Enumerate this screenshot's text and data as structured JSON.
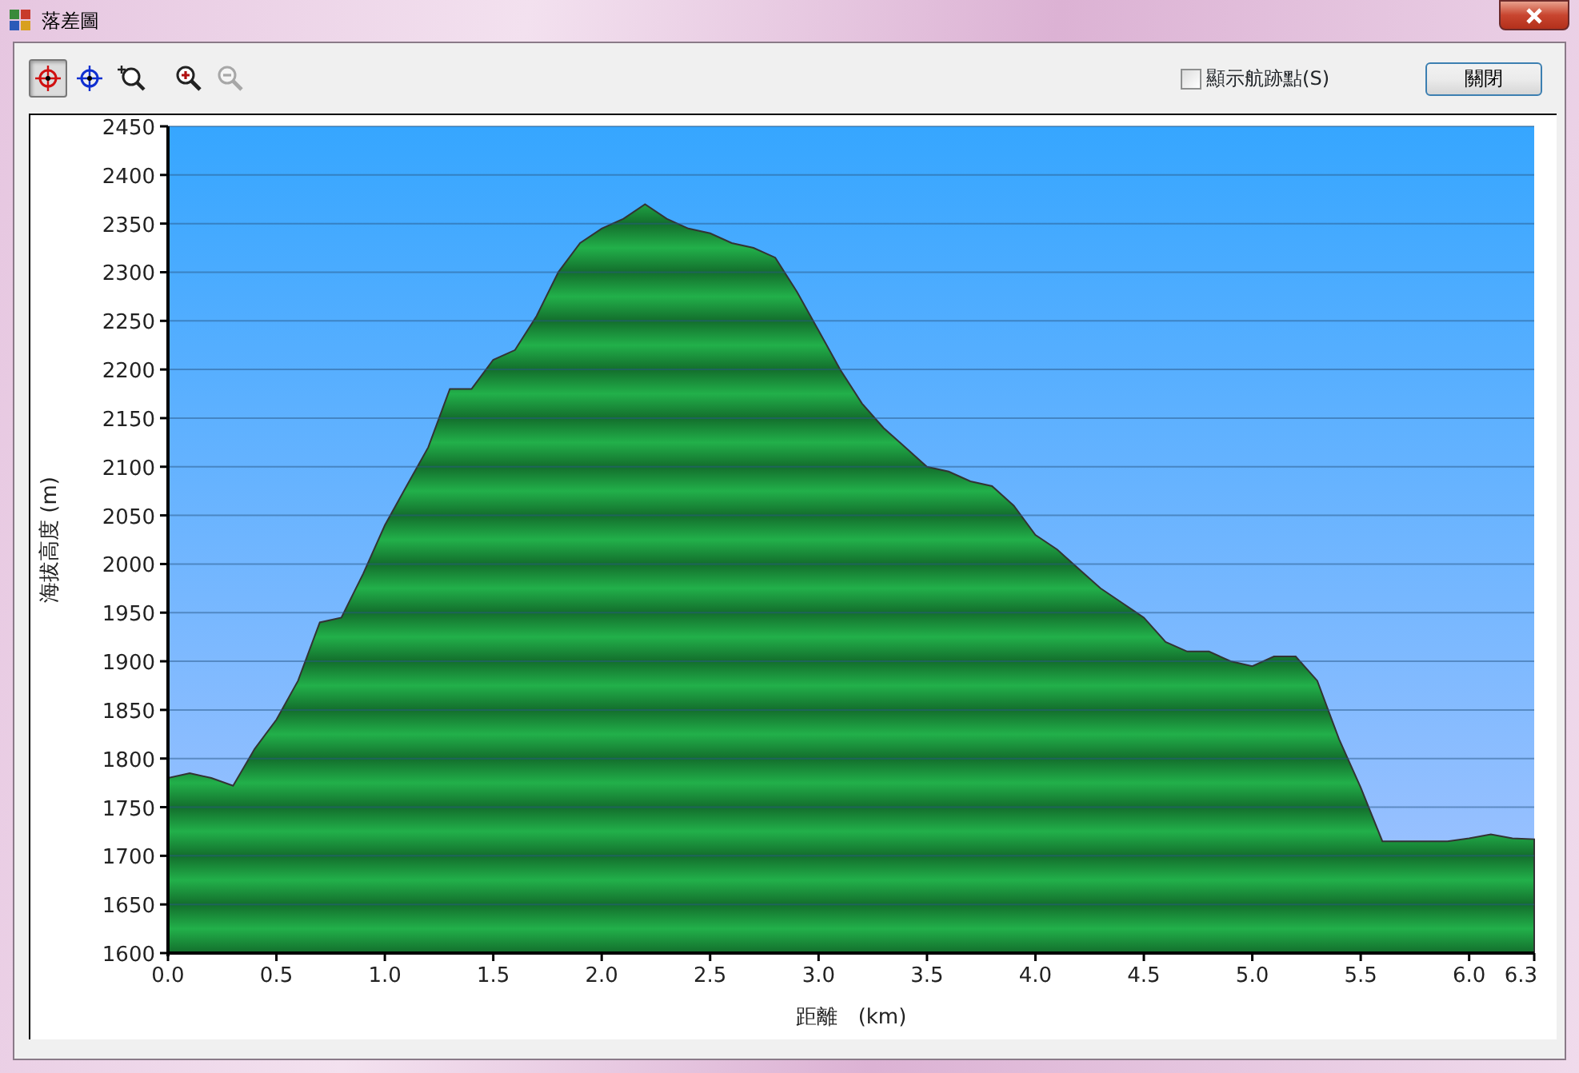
{
  "window": {
    "title": "落差圖"
  },
  "toolbar": {
    "tools": [
      {
        "kind": "crosshair-red",
        "selected": true,
        "disabled": false
      },
      {
        "kind": "crosshair-blue",
        "selected": false,
        "disabled": false
      },
      {
        "kind": "zoom-region",
        "selected": false,
        "disabled": false
      },
      {
        "kind": "zoom-in",
        "selected": false,
        "disabled": false
      },
      {
        "kind": "zoom-out",
        "selected": false,
        "disabled": true
      }
    ],
    "show_track_points": {
      "label": "顯示航跡點(S)",
      "checked": false
    },
    "close_button": "關閉"
  },
  "chart_data": {
    "type": "area",
    "grid": true,
    "xlabel": "距離　(km)",
    "ylabel": "海拔高度 (m)",
    "xlim": [
      0,
      6.3
    ],
    "ylim": [
      1600,
      2450
    ],
    "xticks": [
      {
        "value": 0,
        "label": "0.0"
      },
      {
        "value": 0.5,
        "label": "0.5"
      },
      {
        "value": 1,
        "label": "1.0"
      },
      {
        "value": 1.5,
        "label": "1.5"
      },
      {
        "value": 2,
        "label": "2.0"
      },
      {
        "value": 2.5,
        "label": "2.5"
      },
      {
        "value": 3,
        "label": "3.0"
      },
      {
        "value": 3.5,
        "label": "3.5"
      },
      {
        "value": 4,
        "label": "4.0"
      },
      {
        "value": 4.5,
        "label": "4.5"
      },
      {
        "value": 5,
        "label": "5.0"
      },
      {
        "value": 5.5,
        "label": "5.5"
      },
      {
        "value": 6,
        "label": "6.0"
      },
      {
        "value": 6.3,
        "label": "6.3"
      }
    ],
    "yticks": [
      1600,
      1650,
      1700,
      1750,
      1800,
      1850,
      1900,
      1950,
      2000,
      2050,
      2100,
      2150,
      2200,
      2250,
      2300,
      2350,
      2400,
      2450
    ],
    "x": [
      0,
      0.1,
      0.2,
      0.3,
      0.4,
      0.5,
      0.6,
      0.7,
      0.8,
      0.9,
      1,
      1.1,
      1.2,
      1.3,
      1.4,
      1.5,
      1.6,
      1.7,
      1.8,
      1.9,
      2,
      2.1,
      2.2,
      2.3,
      2.4,
      2.5,
      2.6,
      2.7,
      2.8,
      2.9,
      3,
      3.1,
      3.2,
      3.3,
      3.4,
      3.5,
      3.6,
      3.7,
      3.8,
      3.9,
      4,
      4.1,
      4.2,
      4.3,
      4.4,
      4.5,
      4.6,
      4.7,
      4.8,
      4.9,
      5,
      5.1,
      5.2,
      5.3,
      5.4,
      5.5,
      5.6,
      5.7,
      5.8,
      5.9,
      6,
      6.1,
      6.2,
      6.3
    ],
    "values": [
      1780,
      1785,
      1780,
      1772,
      1810,
      1840,
      1880,
      1940,
      1945,
      1990,
      2040,
      2080,
      2120,
      2180,
      2180,
      2210,
      2220,
      2255,
      2300,
      2330,
      2345,
      2355,
      2370,
      2355,
      2345,
      2340,
      2330,
      2325,
      2315,
      2280,
      2240,
      2200,
      2165,
      2140,
      2120,
      2100,
      2095,
      2085,
      2080,
      2060,
      2030,
      2015,
      1995,
      1975,
      1960,
      1945,
      1920,
      1910,
      1910,
      1900,
      1895,
      1905,
      1905,
      1880,
      1820,
      1770,
      1715,
      1715,
      1715,
      1715,
      1718,
      1722,
      1718,
      1717
    ]
  }
}
